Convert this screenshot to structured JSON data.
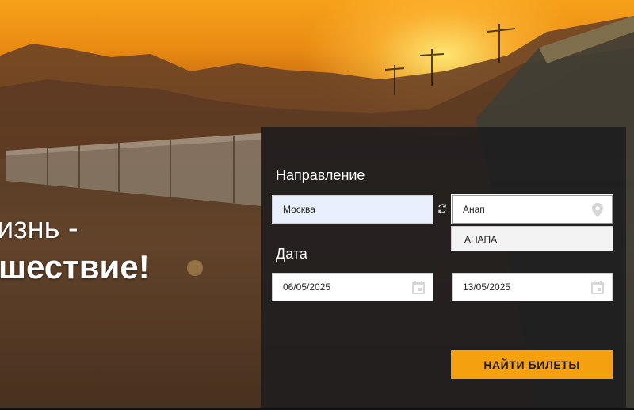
{
  "hero": {
    "headline_line1": "изнь -",
    "headline_line2": "шествие!"
  },
  "form": {
    "direction_label": "Направление",
    "from_value": "Москва",
    "to_value": "Анап",
    "suggestion": "АНАПА",
    "date_label": "Дата",
    "date_from": "06/05/2025",
    "date_to": "13/05/2025",
    "search_button": "НАЙТИ БИЛЕТЫ"
  },
  "colors": {
    "accent": "#f5a10f",
    "panel": "#1c1c1e",
    "autofill": "#e8f0fe"
  },
  "icons": [
    "swap-icon",
    "location-pin-icon",
    "calendar-icon"
  ]
}
